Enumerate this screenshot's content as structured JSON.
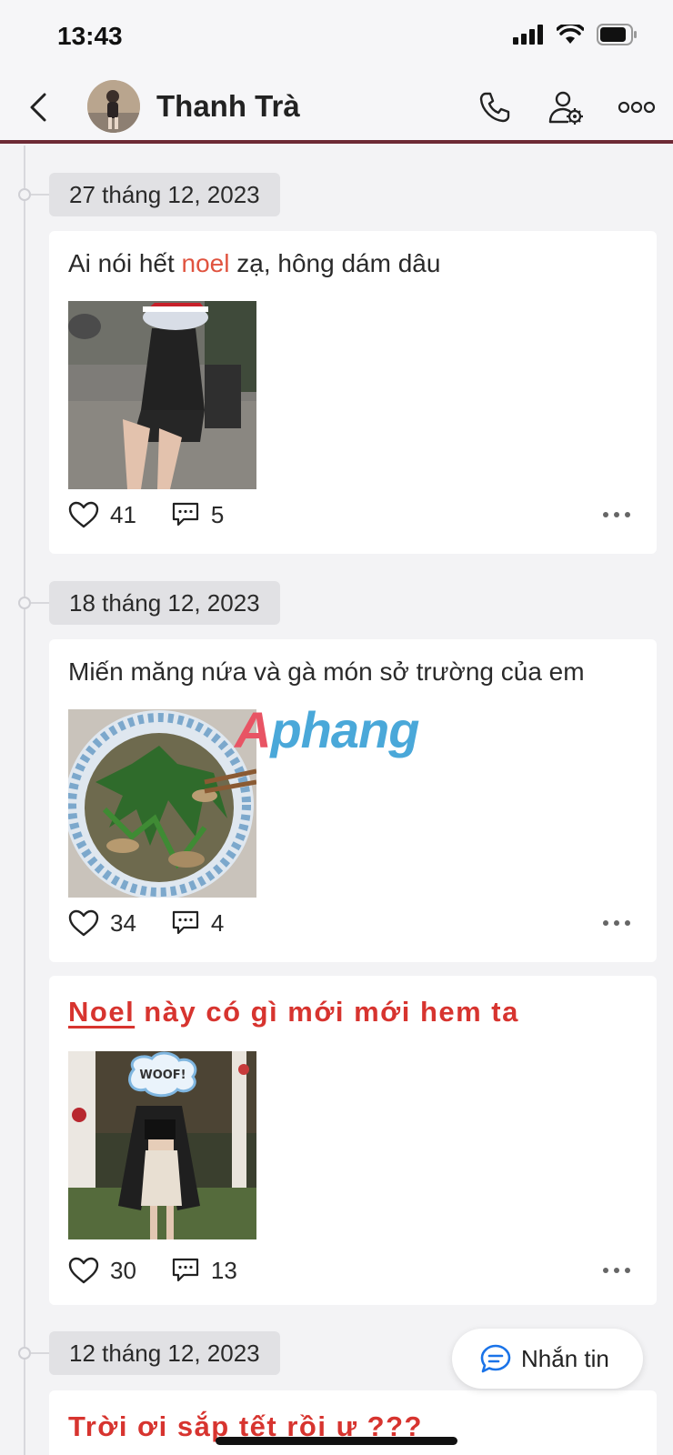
{
  "status_bar": {
    "time": "13:43"
  },
  "header": {
    "name": "Thanh Trà"
  },
  "posts": [
    {
      "date": "27 tháng 12, 2023",
      "text_before": "Ai nói hết ",
      "text_highlight": "noel",
      "text_after": " zạ, hông dám dâu",
      "likes": "41",
      "comments": "5"
    },
    {
      "date": "18 tháng 12, 2023",
      "text": "Miến măng nứa và gà món sở trường của em",
      "likes": "34",
      "comments": "4"
    },
    {
      "styled_underlined": "Noel",
      "styled_rest": " này có gì mới mới hem ta",
      "likes": "30",
      "comments": "13",
      "sticker_text": "WOOF!"
    },
    {
      "date": "12 tháng 12, 2023",
      "styled_text": "Trời ơi sắp tết rồi ư ???"
    }
  ],
  "message_button": {
    "label": "Nhắn tin"
  },
  "watermark": {
    "part_a": "A",
    "part_b": "phang"
  },
  "colors": {
    "accent_red": "#d7342f",
    "highlight": "#e0533f",
    "header_rule": "#6d2a35",
    "message_blue": "#1a73e8"
  }
}
